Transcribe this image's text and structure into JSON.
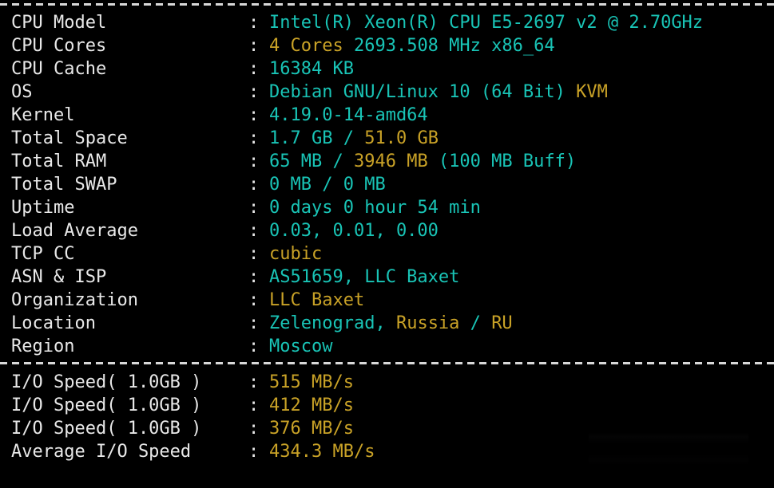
{
  "theme": {
    "background": "#000000",
    "label_color": "#e8e8e8",
    "cyan": "#19c4b6",
    "yellow": "#c9a227",
    "separator_color": "#d8d8d8"
  },
  "separator": {
    "char": "-",
    "top_label": "top-separator",
    "middle_label": "middle-separator"
  },
  "colon": ":",
  "system_info": {
    "rows": [
      {
        "label": "CPU Model",
        "value_text": "Intel(R) Xeon(R) CPU E5-2697 v2 @ 2.70GHz",
        "segments": [
          {
            "text": "Intel(R) Xeon(R) CPU E5-2697 v2 @ 2.70GHz",
            "color": "cyan"
          }
        ]
      },
      {
        "label": "CPU Cores",
        "value_text": "4 Cores 2693.508 MHz x86_64",
        "segments": [
          {
            "text": "4 Cores ",
            "color": "yellow"
          },
          {
            "text": "2693.508 MHz x86_64",
            "color": "cyan"
          }
        ]
      },
      {
        "label": "CPU Cache",
        "value_text": "16384 KB",
        "segments": [
          {
            "text": "16384 KB",
            "color": "cyan"
          }
        ]
      },
      {
        "label": "OS",
        "value_text": "Debian GNU/Linux 10 (64 Bit) KVM",
        "segments": [
          {
            "text": "Debian GNU/Linux 10 (64 Bit) ",
            "color": "cyan"
          },
          {
            "text": "KVM",
            "color": "yellow"
          }
        ]
      },
      {
        "label": "Kernel",
        "value_text": "4.19.0-14-amd64",
        "segments": [
          {
            "text": "4.19.0-14-amd64",
            "color": "cyan"
          }
        ]
      },
      {
        "label": "Total Space",
        "value_text": "1.7 GB / 51.0 GB",
        "segments": [
          {
            "text": "1.7 GB / ",
            "color": "cyan"
          },
          {
            "text": "51.0 GB",
            "color": "yellow"
          }
        ]
      },
      {
        "label": "Total RAM",
        "value_text": "65 MB / 3946 MB (100 MB Buff)",
        "segments": [
          {
            "text": "65 MB / ",
            "color": "cyan"
          },
          {
            "text": "3946 MB",
            "color": "yellow"
          },
          {
            "text": " (100 MB Buff)",
            "color": "cyan"
          }
        ]
      },
      {
        "label": "Total SWAP",
        "value_text": "0 MB / 0 MB",
        "segments": [
          {
            "text": "0 MB / 0 MB",
            "color": "cyan"
          }
        ]
      },
      {
        "label": "Uptime",
        "value_text": "0 days 0 hour 54 min",
        "segments": [
          {
            "text": "0 days 0 hour 54 min",
            "color": "cyan"
          }
        ]
      },
      {
        "label": "Load Average",
        "value_text": "0.03, 0.01, 0.00",
        "segments": [
          {
            "text": "0.03, 0.01, 0.00",
            "color": "cyan"
          }
        ]
      },
      {
        "label": "TCP CC",
        "value_text": "cubic",
        "segments": [
          {
            "text": "cubic",
            "color": "yellow"
          }
        ]
      },
      {
        "label": "ASN & ISP",
        "value_text": "AS51659, LLC Baxet",
        "segments": [
          {
            "text": "AS51659, LLC Baxet",
            "color": "cyan"
          }
        ]
      },
      {
        "label": "Organization",
        "value_text": "LLC Baxet",
        "segments": [
          {
            "text": "LLC Baxet",
            "color": "yellow"
          }
        ]
      },
      {
        "label": "Location",
        "value_text": "Zelenograd, Russia / RU",
        "segments": [
          {
            "text": "Zelenograd, ",
            "color": "cyan"
          },
          {
            "text": "Russia",
            "color": "yellow"
          },
          {
            "text": " / ",
            "color": "cyan"
          },
          {
            "text": "RU",
            "color": "yellow"
          }
        ]
      },
      {
        "label": "Region",
        "value_text": "Moscow",
        "segments": [
          {
            "text": "Moscow",
            "color": "cyan"
          }
        ]
      }
    ]
  },
  "io_test": {
    "rows": [
      {
        "label": "I/O Speed( 1.0GB )",
        "value_text": "515 MB/s",
        "segments": [
          {
            "text": "515 MB/s",
            "color": "yellow"
          }
        ]
      },
      {
        "label": "I/O Speed( 1.0GB )",
        "value_text": "412 MB/s",
        "segments": [
          {
            "text": "412 MB/s",
            "color": "yellow"
          }
        ]
      },
      {
        "label": "I/O Speed( 1.0GB )",
        "value_text": "376 MB/s",
        "segments": [
          {
            "text": "376 MB/s",
            "color": "yellow"
          }
        ]
      },
      {
        "label": "Average I/O Speed",
        "value_text": "434.3 MB/s",
        "segments": [
          {
            "text": "434.3 MB/s",
            "color": "yellow"
          }
        ]
      }
    ]
  }
}
